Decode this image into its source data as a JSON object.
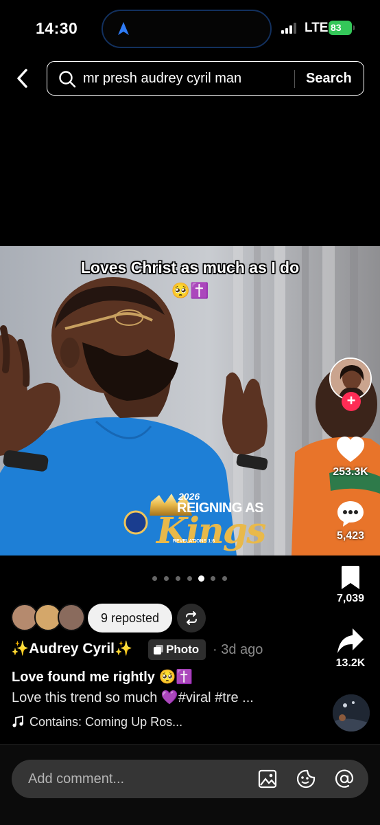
{
  "status": {
    "time": "14:30",
    "network": "LTE",
    "battery": "83"
  },
  "search": {
    "query": "mr presh audrey cyril man",
    "button": "Search"
  },
  "post": {
    "overlay_text": "Loves Christ as much as I do",
    "overlay_emoji": "🥺✝️",
    "banner_year": "2026",
    "banner_line1": "REIGNING AS",
    "banner_line2": "Kings",
    "banner_ref": "REVELATIONS 1:6",
    "carousel": {
      "total": 7,
      "active": 4
    }
  },
  "rail": {
    "likes": "253.3K",
    "comments": "5,423",
    "saves": "7,039",
    "shares": "13.2K"
  },
  "repost": {
    "label": "9 reposted"
  },
  "author": {
    "name": "✨Audrey Cyril✨",
    "type_tag": "Photo",
    "time": "· 3d ago"
  },
  "caption": {
    "title": "Love found me rightly 🥺✝️",
    "description": "Love this trend so much 💜#viral #tre ...",
    "music": "Contains: Coming Up Ros..."
  },
  "comment": {
    "placeholder": "Add comment..."
  },
  "colors": {
    "accent": "#fe2c55",
    "battery": "#34c759",
    "shirt": "#1e7fd6"
  }
}
